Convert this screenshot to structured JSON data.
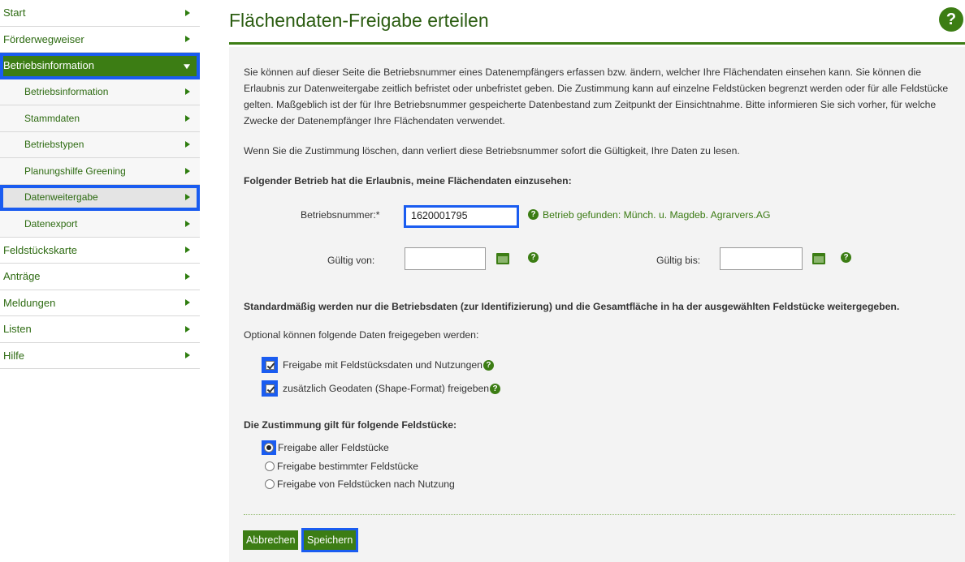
{
  "sidebar": {
    "items": [
      {
        "label": "Start"
      },
      {
        "label": "Förderwegweiser"
      },
      {
        "label": "Betriebsinformation"
      },
      {
        "label": "Betriebsinformation"
      },
      {
        "label": "Stammdaten"
      },
      {
        "label": "Betriebstypen"
      },
      {
        "label": "Planungshilfe Greening"
      },
      {
        "label": "Datenweitergabe"
      },
      {
        "label": "Datenexport"
      },
      {
        "label": "Feldstückskarte"
      },
      {
        "label": "Anträge"
      },
      {
        "label": "Meldungen"
      },
      {
        "label": "Listen"
      },
      {
        "label": "Hilfe"
      }
    ]
  },
  "header": {
    "title": "Flächendaten-Freigabe erteilen",
    "help_icon": "?"
  },
  "intro": "Sie können auf dieser Seite die Betriebsnummer eines Datenempfängers erfassen bzw. ändern, welcher Ihre Flächendaten einsehen kann. Sie können die Erlaubnis zur Datenweitergabe zeitlich befristet oder unbefristet geben. Die Zustimmung kann auf einzelne Feldstücken begrenzt werden oder für alle Feldstücke gelten. Maßgeblich ist der für Ihre Betriebsnummer gespeicherte Datenbestand zum Zeitpunkt der Einsichtnahme. Bitte informieren Sie sich vorher, für welche Zwecke der Datenempfänger Ihre Flächendaten verwendet.",
  "delete_note": "Wenn Sie die Zustimmung löschen, dann verliert diese Betriebsnummer sofort die Gültigkeit, Ihre Daten zu lesen.",
  "permission_heading": "Folgender Betrieb hat die Erlaubnis, meine Flächendaten einzusehen:",
  "form": {
    "betriebsnummer_label": "Betriebsnummer:*",
    "betriebsnummer_value": "1620001795",
    "found_text": "Betrieb gefunden: Münch. u. Magdeb. Agrarvers.AG",
    "valid_from_label": "Gültig von:",
    "valid_from_value": "",
    "valid_to_label": "Gültig bis:",
    "valid_to_value": ""
  },
  "default_note": "Standardmäßig werden nur die Betriebsdaten (zur Identifizierung) und die Gesamtfläche in ha der ausgewählten Feldstücke weitergegeben.",
  "optional_note": "Optional können folgende Daten freigegeben werden:",
  "checkboxes": [
    {
      "label": "Freigabe mit Feldstücksdaten und Nutzungen",
      "checked": true
    },
    {
      "label": "zusätzlich Geodaten (Shape-Format) freigeben",
      "checked": true
    }
  ],
  "scope_heading": "Die Zustimmung gilt für folgende Feldstücke:",
  "radios": [
    {
      "label": "Freigabe aller Feldstücke",
      "checked": true
    },
    {
      "label": "Freigabe bestimmter Feldstücke",
      "checked": false
    },
    {
      "label": "Freigabe von Feldstücken nach Nutzung",
      "checked": false
    }
  ],
  "buttons": {
    "cancel": "Abbrechen",
    "save": "Speichern"
  },
  "colors": {
    "accent": "#3c7d14",
    "highlight": "#1a5cf0"
  },
  "icons": [
    "arrow-right-icon",
    "arrow-down-icon",
    "help-icon",
    "calendar-icon",
    "checkbox-icon",
    "radio-icon"
  ]
}
